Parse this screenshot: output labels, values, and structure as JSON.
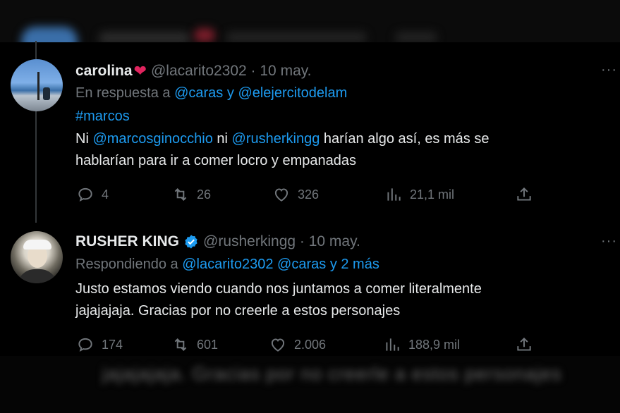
{
  "tweet1": {
    "name": "carolina",
    "handle_date": "@lacarito2302 · 10 may.",
    "more": "···",
    "replying_prefix": "En respuesta a ",
    "replying_link1": "@caras",
    "replying_and": " y ",
    "replying_link2": "@elejercitodelam",
    "hashtag": "#marcos",
    "body_line1_a": "Ni ",
    "body_line1_m1": "@marcosginocchio",
    "body_line1_b": " ni ",
    "body_line1_m2": "@rusherkingg",
    "body_line1_c": " harían algo así, es más se",
    "body_line2": "hablarían para ir a comer locro y empanadas",
    "replies": "4",
    "retweets": "26",
    "likes": "326",
    "views": "21,1 mil"
  },
  "tweet2": {
    "name": "RUSHER KING",
    "handle_date": "@rusherkingg · 10 may.",
    "more": "···",
    "replying_prefix": "Respondiendo a ",
    "replying_link": "@lacarito2302 @caras y 2 más",
    "body_line1": "Justo estamos viendo cuando nos juntamos a comer literalmente",
    "body_line2": "jajajajaja. Gracias por no creerle a estos personajes",
    "replies": "174",
    "retweets": "601",
    "likes": "2.006",
    "views": "188,9 mil"
  },
  "blurred": {
    "line1": "jajajajaja. Gracias por no creerle a estos personajes",
    "line2": ""
  },
  "colors": {
    "background": "#000000",
    "text": "#e7e9ea",
    "muted": "#71767b",
    "link": "#1d9bf0",
    "verified": "#1d9bf0",
    "heart": "#e0245e"
  }
}
